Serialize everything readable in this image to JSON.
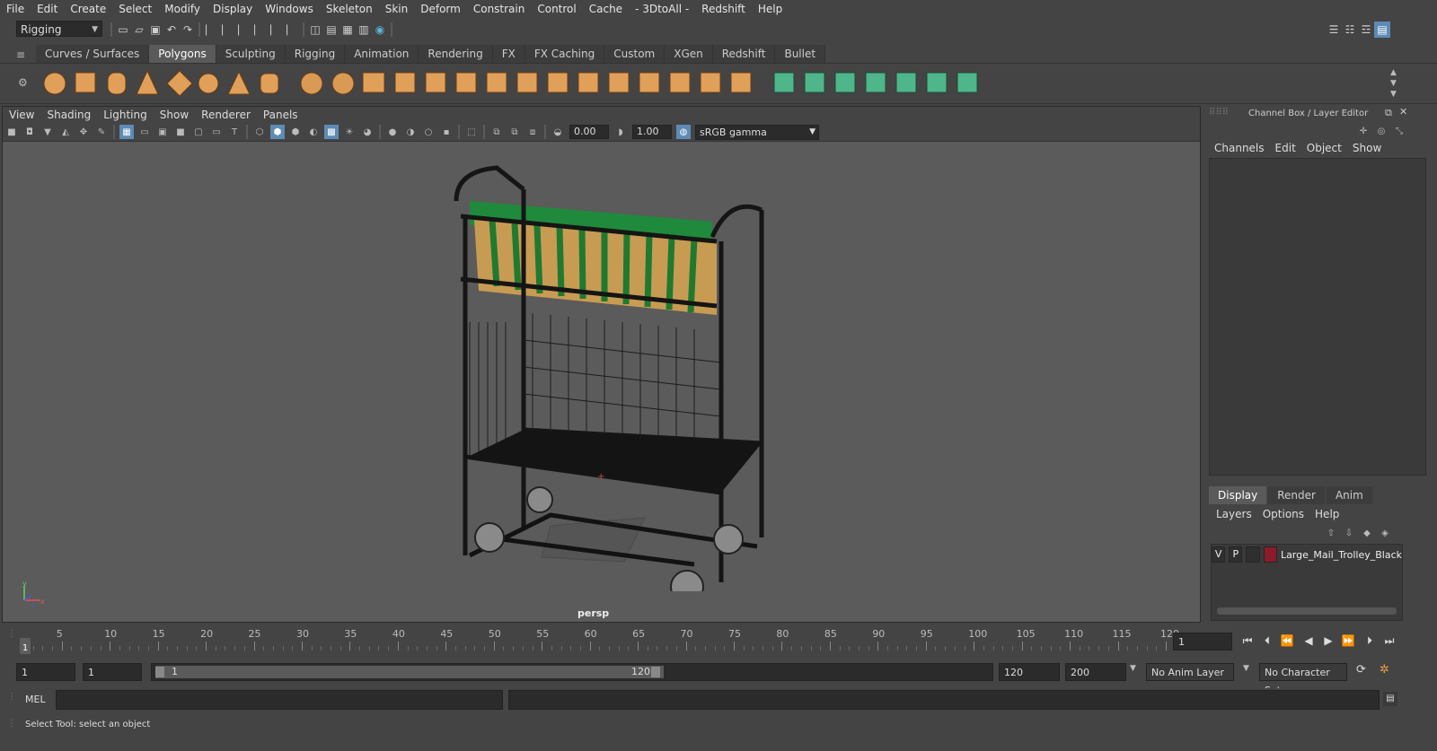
{
  "menubar": [
    "File",
    "Edit",
    "Create",
    "Select",
    "Modify",
    "Display",
    "Windows",
    "Skeleton",
    "Skin",
    "Deform",
    "Constrain",
    "Control",
    "Cache",
    "- 3DtoAll -",
    "Redshift",
    "Help"
  ],
  "mode": "Rigging",
  "shelf_tabs": [
    {
      "label": "Curves / Surfaces",
      "active": false
    },
    {
      "label": "Polygons",
      "active": true
    },
    {
      "label": "Sculpting",
      "active": false
    },
    {
      "label": "Rigging",
      "active": false
    },
    {
      "label": "Animation",
      "active": false
    },
    {
      "label": "Rendering",
      "active": false
    },
    {
      "label": "FX",
      "active": false
    },
    {
      "label": "FX Caching",
      "active": false
    },
    {
      "label": "Custom",
      "active": false
    },
    {
      "label": "XGen",
      "active": false
    },
    {
      "label": "Redshift",
      "active": false
    },
    {
      "label": "Bullet",
      "active": false
    }
  ],
  "viewport": {
    "menu": [
      "View",
      "Shading",
      "Lighting",
      "Show",
      "Renderer",
      "Panels"
    ],
    "exposure": "0.00",
    "gamma_value": "1.00",
    "color_space": "sRGB gamma",
    "camera_label": "persp",
    "axis": {
      "x": "x",
      "y": "y",
      "z": "z"
    }
  },
  "channel_box": {
    "title": "Channel Box / Layer Editor",
    "menu": [
      "Channels",
      "Edit",
      "Object",
      "Show"
    ]
  },
  "layer_editor": {
    "tabs": [
      {
        "label": "Display",
        "active": true
      },
      {
        "label": "Render",
        "active": false
      },
      {
        "label": "Anim",
        "active": false
      }
    ],
    "menu": [
      "Layers",
      "Options",
      "Help"
    ],
    "layers": [
      {
        "v": "V",
        "p": "P",
        "color": "#8b1a2b",
        "name": "Large_Mail_Trolley_Black"
      }
    ]
  },
  "timeline": {
    "labels": [
      "5",
      "10",
      "15",
      "20",
      "25",
      "30",
      "35",
      "40",
      "45",
      "50",
      "55",
      "60",
      "65",
      "70",
      "75",
      "80",
      "85",
      "90",
      "95",
      "100",
      "105",
      "110",
      "115",
      "120"
    ],
    "current_frame_marker": "1",
    "current_frame": "1"
  },
  "range": {
    "start": "1",
    "anim_start": "1",
    "range_start": "1",
    "range_end": "120",
    "end": "120",
    "anim_end": "200",
    "anim_layer": "No Anim Layer",
    "character_set": "No Character Set"
  },
  "mel": {
    "label": "MEL"
  },
  "help_line": "Select Tool: select an object",
  "colors": {
    "accent": "#5d8bb5",
    "layer_color": "#8b1a2b",
    "viewport_bg": "#5b5b5b"
  }
}
